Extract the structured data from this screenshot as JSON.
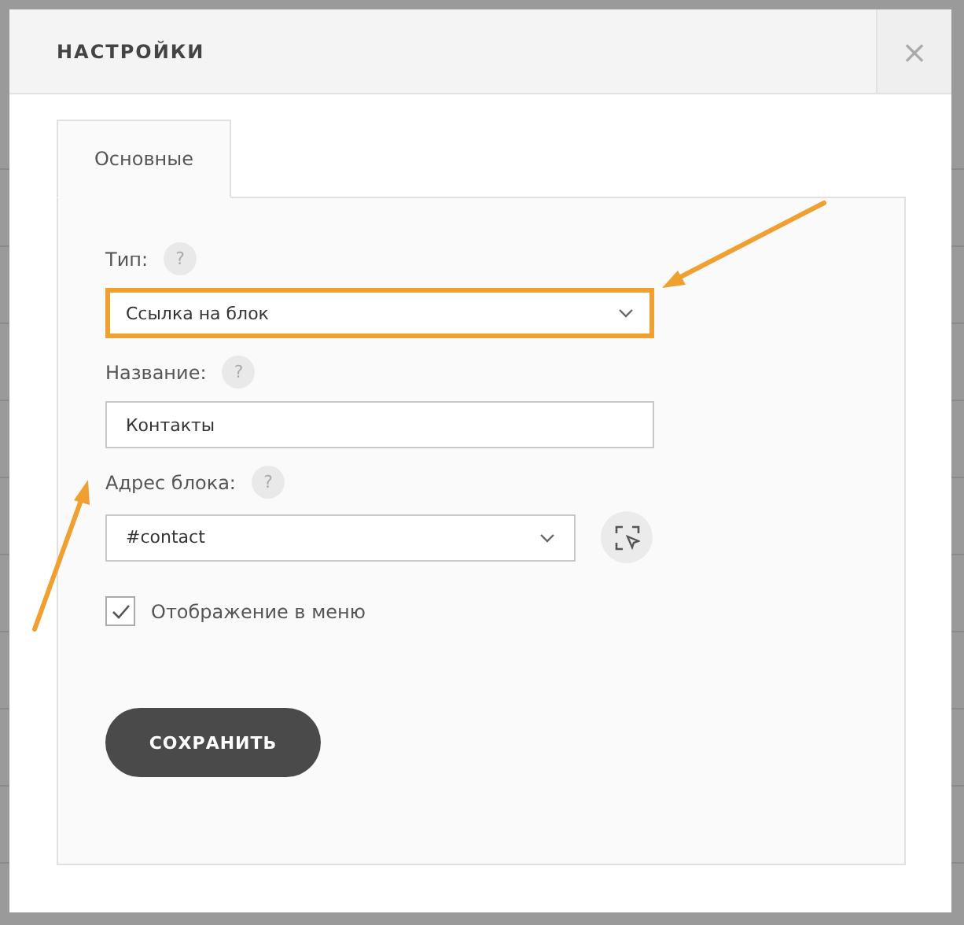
{
  "dialog": {
    "title": "НАСТРОЙКИ",
    "close": "×"
  },
  "tabs": [
    {
      "label": "Основные",
      "selected": true
    }
  ],
  "fields": [
    {
      "kind": "select",
      "label": "Тип:",
      "help": "?",
      "value": "Ссылка на блок",
      "highlighted": true
    },
    {
      "kind": "input",
      "label": "Название:",
      "help": "?",
      "value": "Контакты",
      "highlighted": false
    },
    {
      "kind": "picker",
      "label": "Адрес блока:",
      "help": "?",
      "value": "#contact",
      "highlighted": false
    }
  ],
  "checkbox": {
    "label": "Отображение в меню",
    "checked": true
  },
  "save_button": "СОХРАНИТЬ"
}
